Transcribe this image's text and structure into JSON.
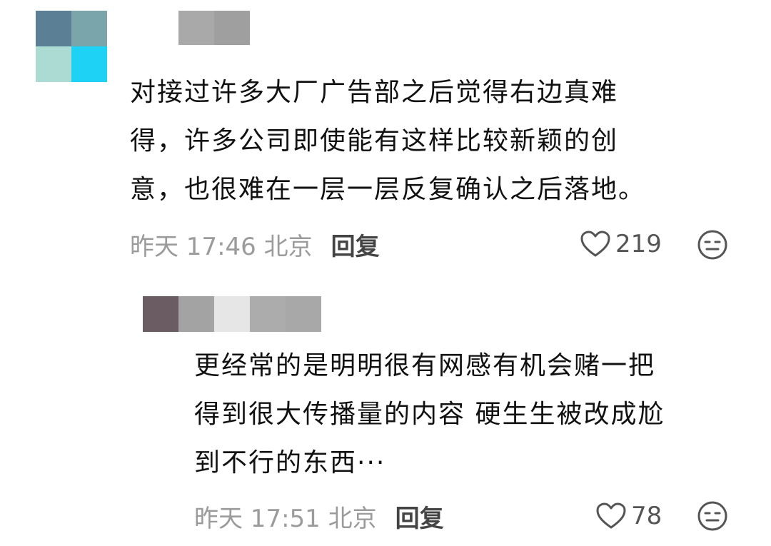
{
  "comments": [
    {
      "text_lines": [
        "对接过许多大厂广告部之后觉得右边真难",
        "得，许多公司即使能有这样比较新颖的创",
        "意，也很难在一层一层反复确认之后落地。"
      ],
      "time": "昨天 17:46 北京",
      "reply_label": "回复",
      "likes": "219",
      "avatar_colors": [
        "#5b7f94",
        "#7aa5aa",
        "#acdbd4",
        "#1ed2f6"
      ],
      "name_colors": [
        "#a9a9a9",
        "#9f9f9f"
      ]
    },
    {
      "text_lines": [
        "更经常的是明明很有网感有机会赌一把",
        "得到很大传播量的内容 硬生生被改成尬",
        "到不行的东西···"
      ],
      "time": "昨天 17:51 北京",
      "reply_label": "回复",
      "likes": "78",
      "name_colors": [
        "#6a5c62",
        "#a3a3a3",
        "#e6e6e6",
        "#acacac",
        "#a8a8a8"
      ]
    }
  ],
  "icons": {
    "like": "heart-outline-icon",
    "reaction": "face-neutral-icon"
  },
  "colors": {
    "meta_text": "#9b9b9b",
    "reply": "#444444",
    "icon": "#555555"
  }
}
